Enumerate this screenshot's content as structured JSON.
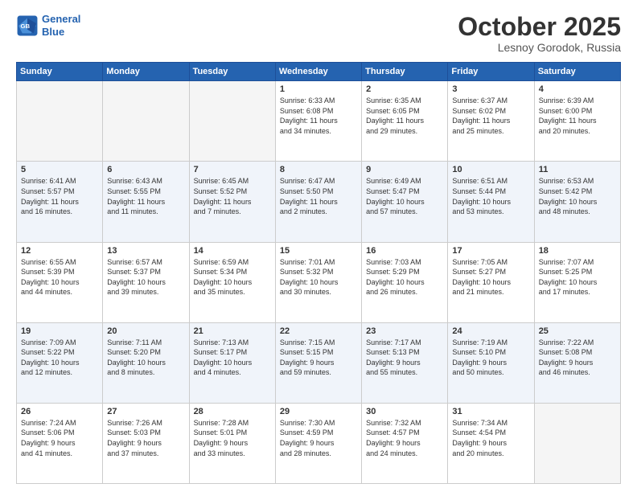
{
  "header": {
    "logo_line1": "General",
    "logo_line2": "Blue",
    "month_title": "October 2025",
    "location": "Lesnoy Gorodok, Russia"
  },
  "weekdays": [
    "Sunday",
    "Monday",
    "Tuesday",
    "Wednesday",
    "Thursday",
    "Friday",
    "Saturday"
  ],
  "weeks": [
    [
      {
        "day": "",
        "info": ""
      },
      {
        "day": "",
        "info": ""
      },
      {
        "day": "",
        "info": ""
      },
      {
        "day": "1",
        "info": "Sunrise: 6:33 AM\nSunset: 6:08 PM\nDaylight: 11 hours\nand 34 minutes."
      },
      {
        "day": "2",
        "info": "Sunrise: 6:35 AM\nSunset: 6:05 PM\nDaylight: 11 hours\nand 29 minutes."
      },
      {
        "day": "3",
        "info": "Sunrise: 6:37 AM\nSunset: 6:02 PM\nDaylight: 11 hours\nand 25 minutes."
      },
      {
        "day": "4",
        "info": "Sunrise: 6:39 AM\nSunset: 6:00 PM\nDaylight: 11 hours\nand 20 minutes."
      }
    ],
    [
      {
        "day": "5",
        "info": "Sunrise: 6:41 AM\nSunset: 5:57 PM\nDaylight: 11 hours\nand 16 minutes."
      },
      {
        "day": "6",
        "info": "Sunrise: 6:43 AM\nSunset: 5:55 PM\nDaylight: 11 hours\nand 11 minutes."
      },
      {
        "day": "7",
        "info": "Sunrise: 6:45 AM\nSunset: 5:52 PM\nDaylight: 11 hours\nand 7 minutes."
      },
      {
        "day": "8",
        "info": "Sunrise: 6:47 AM\nSunset: 5:50 PM\nDaylight: 11 hours\nand 2 minutes."
      },
      {
        "day": "9",
        "info": "Sunrise: 6:49 AM\nSunset: 5:47 PM\nDaylight: 10 hours\nand 57 minutes."
      },
      {
        "day": "10",
        "info": "Sunrise: 6:51 AM\nSunset: 5:44 PM\nDaylight: 10 hours\nand 53 minutes."
      },
      {
        "day": "11",
        "info": "Sunrise: 6:53 AM\nSunset: 5:42 PM\nDaylight: 10 hours\nand 48 minutes."
      }
    ],
    [
      {
        "day": "12",
        "info": "Sunrise: 6:55 AM\nSunset: 5:39 PM\nDaylight: 10 hours\nand 44 minutes."
      },
      {
        "day": "13",
        "info": "Sunrise: 6:57 AM\nSunset: 5:37 PM\nDaylight: 10 hours\nand 39 minutes."
      },
      {
        "day": "14",
        "info": "Sunrise: 6:59 AM\nSunset: 5:34 PM\nDaylight: 10 hours\nand 35 minutes."
      },
      {
        "day": "15",
        "info": "Sunrise: 7:01 AM\nSunset: 5:32 PM\nDaylight: 10 hours\nand 30 minutes."
      },
      {
        "day": "16",
        "info": "Sunrise: 7:03 AM\nSunset: 5:29 PM\nDaylight: 10 hours\nand 26 minutes."
      },
      {
        "day": "17",
        "info": "Sunrise: 7:05 AM\nSunset: 5:27 PM\nDaylight: 10 hours\nand 21 minutes."
      },
      {
        "day": "18",
        "info": "Sunrise: 7:07 AM\nSunset: 5:25 PM\nDaylight: 10 hours\nand 17 minutes."
      }
    ],
    [
      {
        "day": "19",
        "info": "Sunrise: 7:09 AM\nSunset: 5:22 PM\nDaylight: 10 hours\nand 12 minutes."
      },
      {
        "day": "20",
        "info": "Sunrise: 7:11 AM\nSunset: 5:20 PM\nDaylight: 10 hours\nand 8 minutes."
      },
      {
        "day": "21",
        "info": "Sunrise: 7:13 AM\nSunset: 5:17 PM\nDaylight: 10 hours\nand 4 minutes."
      },
      {
        "day": "22",
        "info": "Sunrise: 7:15 AM\nSunset: 5:15 PM\nDaylight: 9 hours\nand 59 minutes."
      },
      {
        "day": "23",
        "info": "Sunrise: 7:17 AM\nSunset: 5:13 PM\nDaylight: 9 hours\nand 55 minutes."
      },
      {
        "day": "24",
        "info": "Sunrise: 7:19 AM\nSunset: 5:10 PM\nDaylight: 9 hours\nand 50 minutes."
      },
      {
        "day": "25",
        "info": "Sunrise: 7:22 AM\nSunset: 5:08 PM\nDaylight: 9 hours\nand 46 minutes."
      }
    ],
    [
      {
        "day": "26",
        "info": "Sunrise: 7:24 AM\nSunset: 5:06 PM\nDaylight: 9 hours\nand 41 minutes."
      },
      {
        "day": "27",
        "info": "Sunrise: 7:26 AM\nSunset: 5:03 PM\nDaylight: 9 hours\nand 37 minutes."
      },
      {
        "day": "28",
        "info": "Sunrise: 7:28 AM\nSunset: 5:01 PM\nDaylight: 9 hours\nand 33 minutes."
      },
      {
        "day": "29",
        "info": "Sunrise: 7:30 AM\nSunset: 4:59 PM\nDaylight: 9 hours\nand 28 minutes."
      },
      {
        "day": "30",
        "info": "Sunrise: 7:32 AM\nSunset: 4:57 PM\nDaylight: 9 hours\nand 24 minutes."
      },
      {
        "day": "31",
        "info": "Sunrise: 7:34 AM\nSunset: 4:54 PM\nDaylight: 9 hours\nand 20 minutes."
      },
      {
        "day": "",
        "info": ""
      }
    ]
  ]
}
